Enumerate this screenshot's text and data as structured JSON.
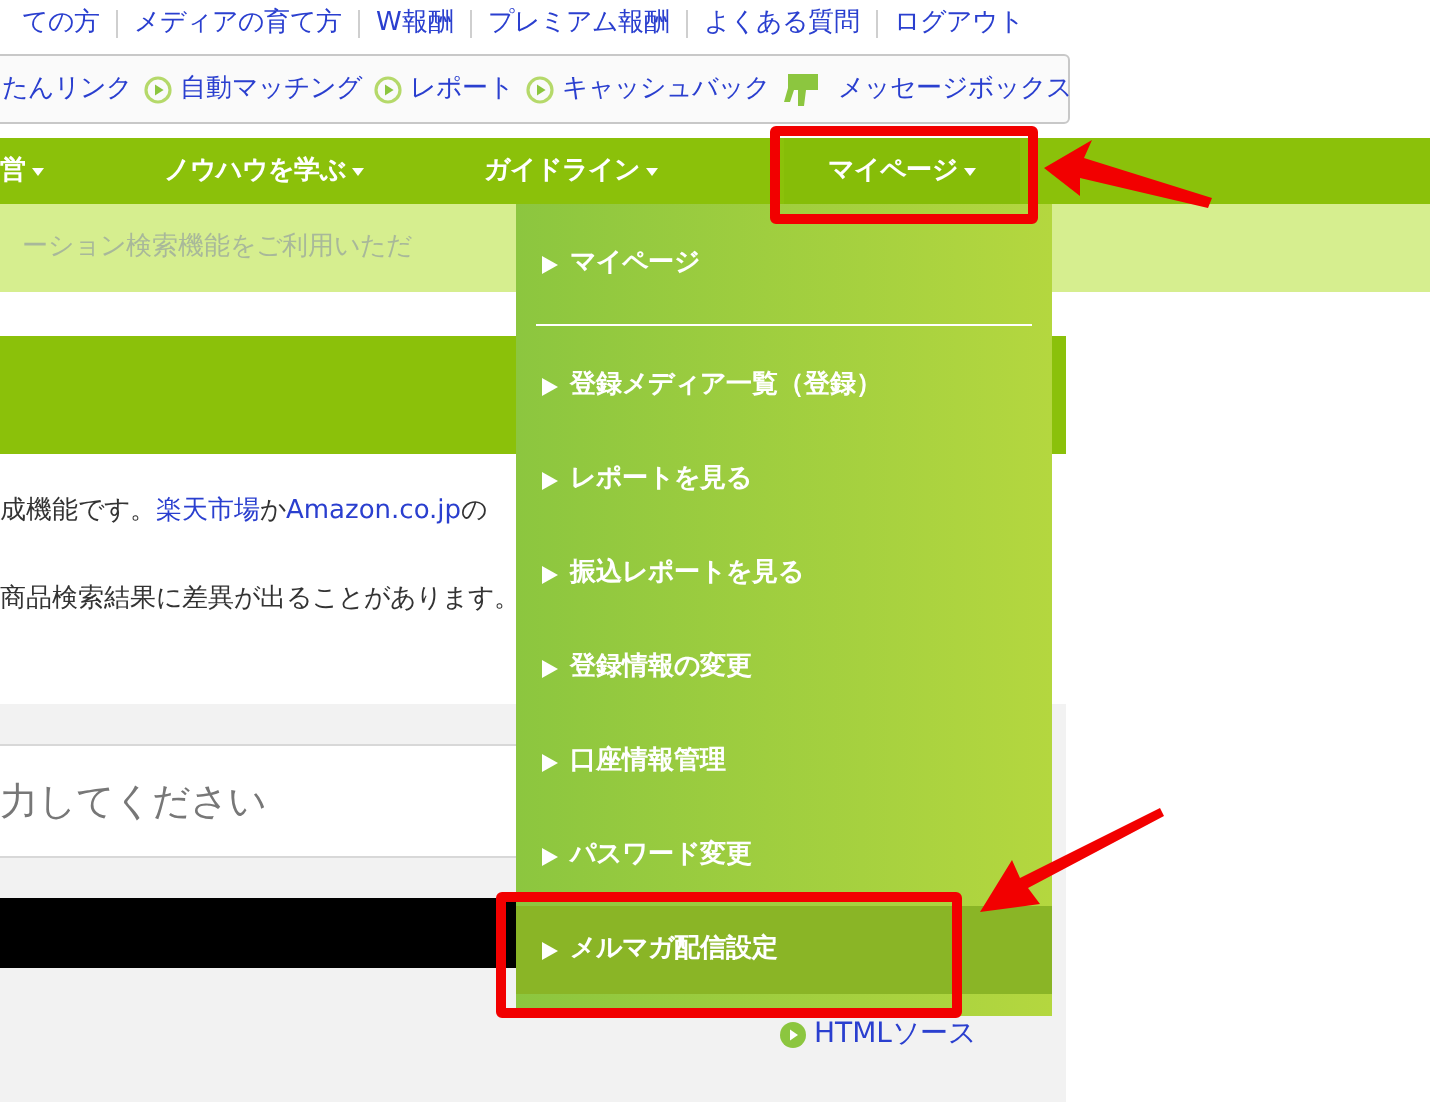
{
  "top_links": [
    "ての方",
    "メディアの育て方",
    "W報酬",
    "プレミアム報酬",
    "よくある質問",
    "ログアウト"
  ],
  "shortcuts": [
    {
      "label": "たんリンク",
      "kind": "plain"
    },
    {
      "label": "自動マッチング",
      "kind": "play"
    },
    {
      "label": "レポート",
      "kind": "play"
    },
    {
      "label": "キャッシュバック",
      "kind": "play"
    },
    {
      "label": "メッセージボックス",
      "kind": "message"
    }
  ],
  "nav": [
    {
      "label": "営",
      "selected": false
    },
    {
      "label": "ノウハウを学ぶ",
      "selected": false
    },
    {
      "label": "ガイドライン",
      "selected": false
    },
    {
      "label": "マイページ",
      "selected": true
    }
  ],
  "notice": "ーション検索機能をご利用いただ",
  "description": [
    [
      {
        "text": "成機能です。",
        "link": false
      },
      {
        "text": "楽天市場",
        "link": true
      },
      {
        "text": "か",
        "link": false
      },
      {
        "text": "Amazon.co.jp",
        "link": true
      },
      {
        "text": "の",
        "link": false
      }
    ],
    [
      {
        "text": "商品検索結果に差異が出ることがあります。",
        "link": false
      }
    ]
  ],
  "search": {
    "placeholder": "力してください"
  },
  "html_source_link": "HTMLソース",
  "dropdown": {
    "items": [
      {
        "label": "マイページ",
        "highlighted": false,
        "divider_after": true
      },
      {
        "label": "登録メディア一覧（登録）",
        "highlighted": false,
        "divider_after": false
      },
      {
        "label": "レポートを見る",
        "highlighted": false,
        "divider_after": false
      },
      {
        "label": "振込レポートを見る",
        "highlighted": false,
        "divider_after": false
      },
      {
        "label": "登録情報の変更",
        "highlighted": false,
        "divider_after": false
      },
      {
        "label": "口座情報管理",
        "highlighted": false,
        "divider_after": false
      },
      {
        "label": "パスワード変更",
        "highlighted": false,
        "divider_after": false
      },
      {
        "label": "メルマガ配信設定",
        "highlighted": true,
        "divider_after": false
      }
    ]
  }
}
